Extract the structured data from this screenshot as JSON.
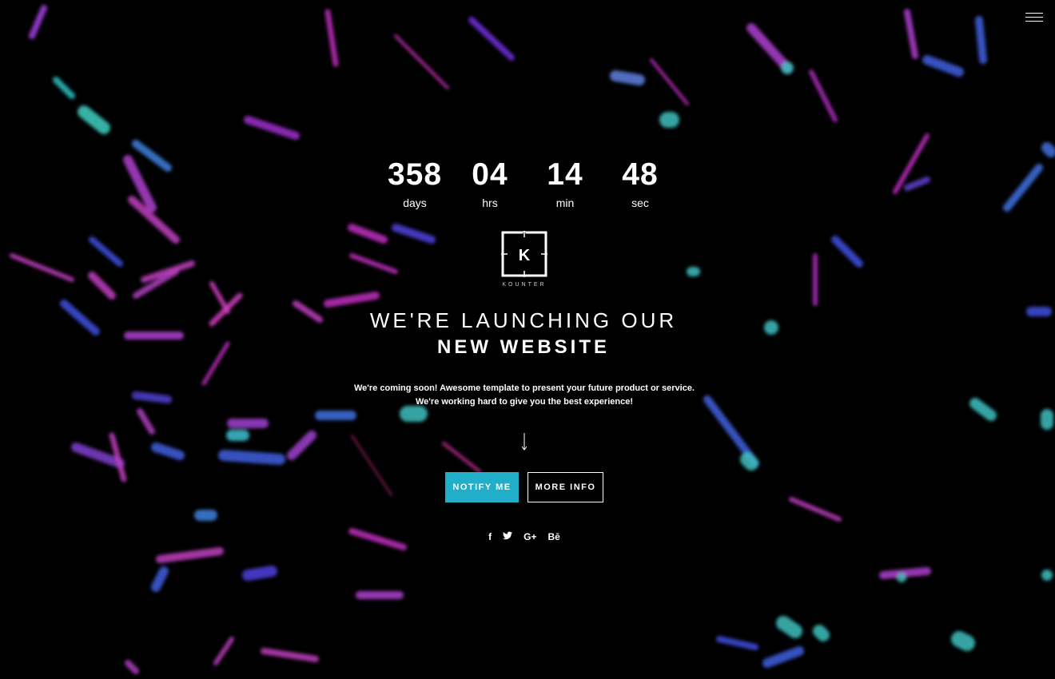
{
  "countdown": [
    {
      "value": "358",
      "label": "days"
    },
    {
      "value": "04",
      "label": "hrs"
    },
    {
      "value": "14",
      "label": "min"
    },
    {
      "value": "48",
      "label": "sec"
    }
  ],
  "logo": {
    "letter": "K",
    "text": "KOUNTER"
  },
  "headline": {
    "line1": "WE'RE LAUNCHING OUR",
    "line2": "NEW WEBSITE"
  },
  "description": {
    "line1": "We're coming soon! Awesome template to present your future product or service.",
    "line2": "We're working hard to give you the best experience!"
  },
  "buttons": {
    "notify": "NOTIFY ME",
    "more": "MORE INFO"
  },
  "social": {
    "facebook": "f",
    "twitter": "t",
    "googleplus": "G+",
    "behance": "Bē"
  },
  "colors": {
    "accent": "#21aec8",
    "background": "#000000"
  }
}
